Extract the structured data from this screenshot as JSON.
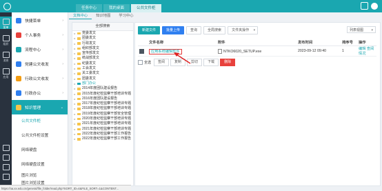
{
  "top_tabs": [
    {
      "label": "任务中心"
    },
    {
      "label": "我的桌面"
    },
    {
      "label": "公共文件柜"
    }
  ],
  "rail": [
    {
      "label": "菜单"
    },
    {
      "label": "组织"
    },
    {
      "label": "消息"
    },
    {
      "label": "应用"
    }
  ],
  "menu": {
    "items": [
      {
        "label": "快捷菜单",
        "color": "#2f7ff0"
      },
      {
        "label": "个人事务",
        "color": "#e8413c"
      },
      {
        "label": "流程中心",
        "color": "#1aa7b0"
      },
      {
        "label": "党建公文收发",
        "color": "#2f7ff0"
      },
      {
        "label": "行政公文收发",
        "color": "#f39c12"
      },
      {
        "label": "行政办公",
        "color": "#2f7ff0"
      },
      {
        "label": "知识管理",
        "color": "#f6c54a"
      }
    ],
    "subitems": [
      {
        "label": "公共文件柜"
      },
      {
        "label": "公共文件柜设置"
      },
      {
        "label": "网络硬盘"
      },
      {
        "label": "网络硬盘设置"
      },
      {
        "label": "图片浏览"
      },
      {
        "label": "图片浏览设置"
      }
    ],
    "last": {
      "label": "智能门户",
      "color": "#e8413c"
    }
  },
  "breadcrumbs": [
    {
      "label": "文档中心"
    },
    {
      "label": "知识地图"
    },
    {
      "label": "学习中心"
    }
  ],
  "tree": {
    "header": "全部搜索",
    "rows": [
      {
        "label": "党委发文"
      },
      {
        "label": "团委发文"
      },
      {
        "label": "行政发文"
      },
      {
        "label": "组织部发文"
      },
      {
        "label": "宣传部发文"
      },
      {
        "label": "统战部发文"
      },
      {
        "label": "纪委发文"
      },
      {
        "label": "工会发文"
      },
      {
        "label": "关工委发文"
      },
      {
        "label": "团委发文"
      },
      {
        "label": "部门办公"
      },
      {
        "label": "2014年度团队建设报告"
      },
      {
        "label": "2015年度纪检监察干部培训专题"
      },
      {
        "label": "2016年度团队建设报告"
      },
      {
        "label": "2017年度纪检监察干部培训专题"
      },
      {
        "label": "2018年度纪检监察干部培训专题"
      },
      {
        "label": "2019年度纪检监察干部安全管理"
      },
      {
        "label": "2020年度纪检监察干部培训专题"
      },
      {
        "label": "2021年度纪检监察干部培训专题"
      },
      {
        "label": "2021年度纪检监察干部培训专题"
      },
      {
        "label": "2022年度纪检监察干部工作报告"
      },
      {
        "label": "2022年度纪检监察干部工作报告"
      }
    ]
  },
  "toolbar": {
    "new_file": "新建文件",
    "batch_upload": "批量上传",
    "search": "查询",
    "all_search": "全局搜索",
    "file_ops": "文件夹操作",
    "view_mode": "列表视图"
  },
  "table": {
    "headers": [
      "文件名称",
      "附件",
      "发布时间",
      "排序号",
      "操作"
    ],
    "rows": [
      {
        "name": "应用系统编辑软件",
        "attachment": "NTKO6020_SETUP.exe",
        "time": "2023-09-12 09:40",
        "order": "1",
        "edit": "编辑",
        "prop": "查阅情况"
      }
    ]
  },
  "bottom": {
    "select_all": "全选",
    "actions": [
      "签阅",
      "复制",
      "剪切",
      "下载"
    ],
    "delete": "删除"
  },
  "status_url": "https://oa.xx.edu.cn/general/file_folder/read.php?SORT_ID=4&FILE_SORT=1&CONTENT..."
}
